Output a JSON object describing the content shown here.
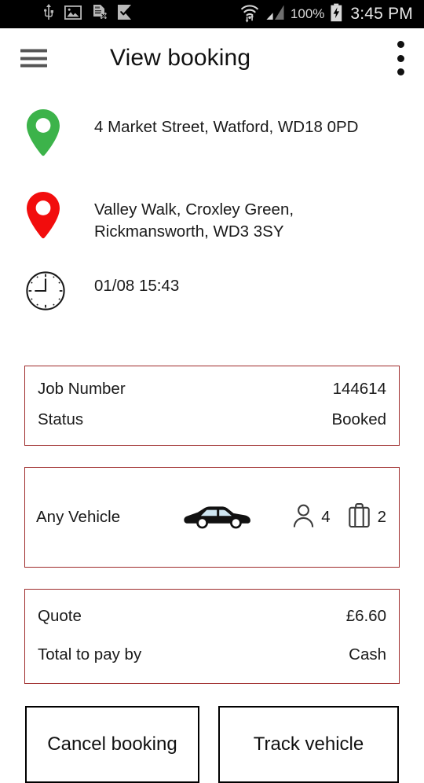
{
  "statusbar": {
    "icons_left": [
      "usb-icon",
      "photo-icon",
      "sdcard-removed-icon",
      "checkmark-flag-icon"
    ],
    "wifi_icon": "wifi-icon",
    "signal_icon": "cell-signal-icon",
    "battery_percent": "100%",
    "battery_icon": "battery-charging-icon",
    "time": "3:45 PM"
  },
  "appbar": {
    "menu_icon": "hamburger-menu-icon",
    "title": "View booking",
    "overflow_icon": "overflow-menu-icon"
  },
  "trip": {
    "pickup": {
      "icon": "map-pin-green-icon",
      "address": "4 Market Street, Watford, WD18 0PD"
    },
    "dropoff": {
      "icon": "map-pin-red-icon",
      "address_line1": "Valley Walk, Croxley Green,",
      "address_line2": "Rickmansworth, WD3 3SY"
    },
    "time": {
      "icon": "clock-icon",
      "value": "01/08 15:43"
    }
  },
  "cards": {
    "job": {
      "rows": [
        {
          "label": "Job Number",
          "value": "144614"
        },
        {
          "label": "Status",
          "value": "Booked"
        }
      ]
    },
    "vehicle": {
      "name": "Any Vehicle",
      "car_icon": "sedan-car-icon",
      "passenger_icon": "person-icon",
      "passengers": "4",
      "luggage_icon": "suitcase-icon",
      "luggage": "2"
    },
    "quote": {
      "rows": [
        {
          "label": "Quote",
          "value": "£6.60"
        },
        {
          "label": "Total to pay by",
          "value": "Cash"
        }
      ]
    }
  },
  "actions": {
    "cancel_label": "Cancel booking",
    "track_label": "Track vehicle"
  },
  "colors": {
    "card_border": "#9e2b2b",
    "pickup_pin": "#3cb34a",
    "dropoff_pin": "#f20d0d",
    "statusbar_bg": "#000000",
    "page_bg": "#ffffff"
  }
}
